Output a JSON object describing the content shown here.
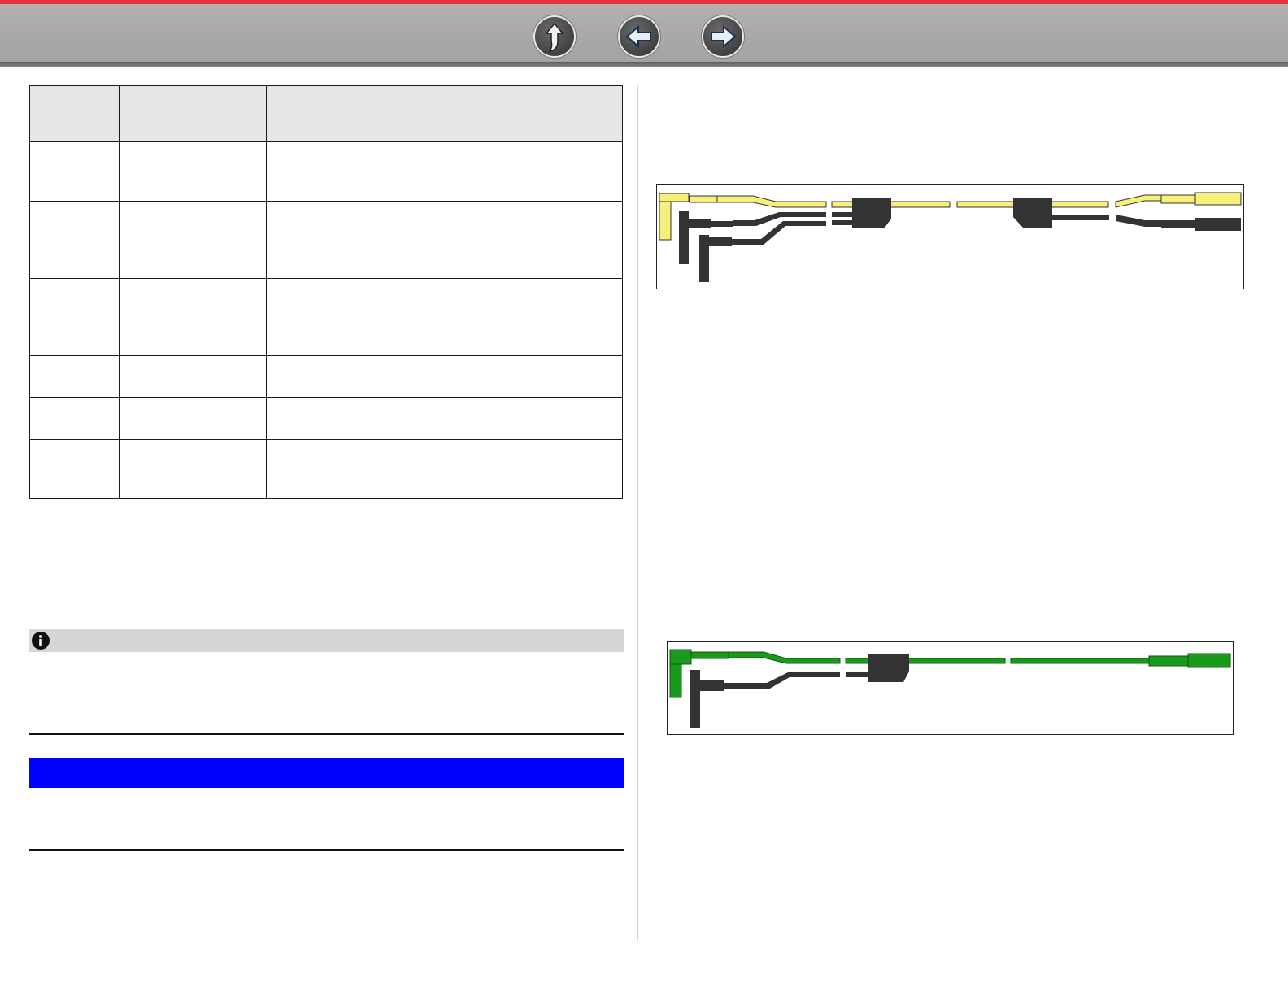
{
  "toolbar": {
    "buttons": [
      {
        "name": "up-button",
        "icon": "up-arrow-icon"
      },
      {
        "name": "back-button",
        "icon": "left-arrow-icon"
      },
      {
        "name": "forward-button",
        "icon": "right-arrow-icon"
      }
    ],
    "colors": {
      "accent": "#e0333c",
      "bar": "#a8a8a8"
    }
  },
  "table": {
    "columns": [
      "",
      "",
      "",
      "",
      ""
    ],
    "rows": [
      [
        "",
        "",
        "",
        "",
        ""
      ],
      [
        "",
        "",
        "",
        "",
        ""
      ],
      [
        "",
        "",
        "",
        "",
        ""
      ],
      [
        "",
        "",
        "",
        "",
        ""
      ],
      [
        "",
        "",
        "",
        "",
        ""
      ],
      [
        "",
        "",
        "",
        "",
        ""
      ]
    ]
  },
  "note": {
    "icon": "info-icon",
    "text": ""
  },
  "section": {
    "heading": "",
    "color": "#0000ff"
  },
  "figures": [
    {
      "name": "yellow-black-test-lead-figure",
      "colors": [
        "#f7ef7a",
        "#333333"
      ]
    },
    {
      "name": "green-black-test-lead-figure",
      "colors": [
        "#1a9a1a",
        "#333333"
      ]
    }
  ]
}
